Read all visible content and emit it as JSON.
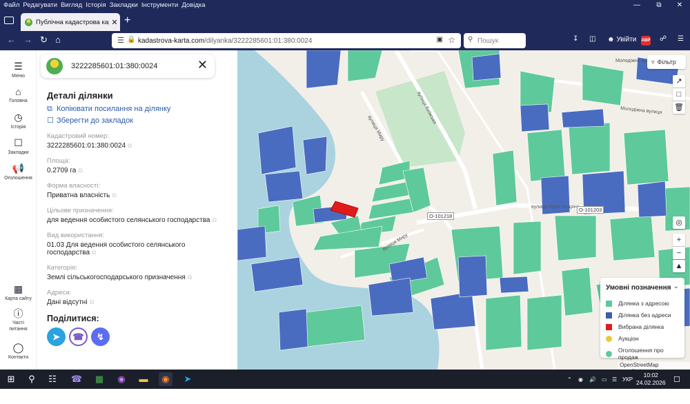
{
  "menubar": {
    "items": [
      "Файл",
      "Редагувати",
      "Вигляд",
      "Історія",
      "Закладки",
      "Інструменти",
      "Довідка"
    ]
  },
  "tab": {
    "title": "Публічна кадастрова карта Ук"
  },
  "address": {
    "host": "kadastrova-karta.com",
    "path": "/dilyanka/3222285601:01:380:0024"
  },
  "search": {
    "placeholder": "Пошук"
  },
  "account": {
    "login_label": "Увійти",
    "abp_label": "ABP"
  },
  "sidebar": {
    "items": [
      {
        "label": "Меню",
        "icon": "menu-icon"
      },
      {
        "label": "Головна",
        "icon": "home-icon"
      },
      {
        "label": "Історія",
        "icon": "history-icon"
      },
      {
        "label": "Закладки",
        "icon": "bookmark-icon"
      },
      {
        "label": "Оголошення",
        "icon": "megaphone-icon"
      },
      {
        "label": "Карта сайту",
        "icon": "map-icon"
      },
      {
        "label": "Часті питання",
        "icon": "question-icon"
      },
      {
        "label": "Контакти",
        "icon": "chat-icon"
      }
    ]
  },
  "panel": {
    "query": "3222285601:01:380:0024",
    "heading": "Деталі ділянки",
    "copy_link": "Копіювати посилання на ділянку",
    "save_bookmark": "Зберегти до закладок",
    "fields": [
      {
        "label": "Кадастровий номер:",
        "value": "3222285601:01:380:0024"
      },
      {
        "label": "Площа:",
        "value": "0.2709 га"
      },
      {
        "label": "Форма власності:",
        "value": "Приватна власність"
      },
      {
        "label": "Цільове призначення:",
        "value": "для ведення особистого селянського господарства"
      },
      {
        "label": "Вид використання:",
        "value": "01.03 Для ведення особистого селянського господарства"
      },
      {
        "label": "Категорія:",
        "value": "Землі сільськогосподарського призначення"
      },
      {
        "label": "Адреса:",
        "value": "Дані відсутні"
      }
    ],
    "share_title": "Поділитися:"
  },
  "map": {
    "filter_label": "Фільтр",
    "streets": {
      "molodizhna_top": "Молодіжна вулиця",
      "molodizhna": "Молодіжна вулиця",
      "kyyivska": "вулиця Київська",
      "myru": "вулиця Миру",
      "myru2": "вулиця Миру",
      "haharina": "вулиця Юрія Гагаріна",
      "road1": "О-101218",
      "road2": "О-101203"
    },
    "legend": {
      "title": "Умовні позначення",
      "items": [
        {
          "label": "Ділянка з адресою",
          "color": "#5ec99a"
        },
        {
          "label": "Ділянка без адреси",
          "color": "#3a5db0"
        },
        {
          "label": "Вибрана ділянка",
          "color": "#e01b1b"
        },
        {
          "label": "Аукціон",
          "color": "#f0c53a"
        },
        {
          "label": "Оголошення про продаж",
          "color": "#5ec99a"
        }
      ]
    },
    "attribution": "OpenStreetMap contributors",
    "colors": {
      "water": "#aad3df",
      "parcel_addr": "#5ec99a",
      "parcel_noaddr": "#4a6cc0",
      "selected": "#e01b1b",
      "park": "#c8e6c9"
    }
  },
  "taskbar": {
    "lang": "УКР",
    "time": "10:02",
    "date": "24.02.2026"
  }
}
